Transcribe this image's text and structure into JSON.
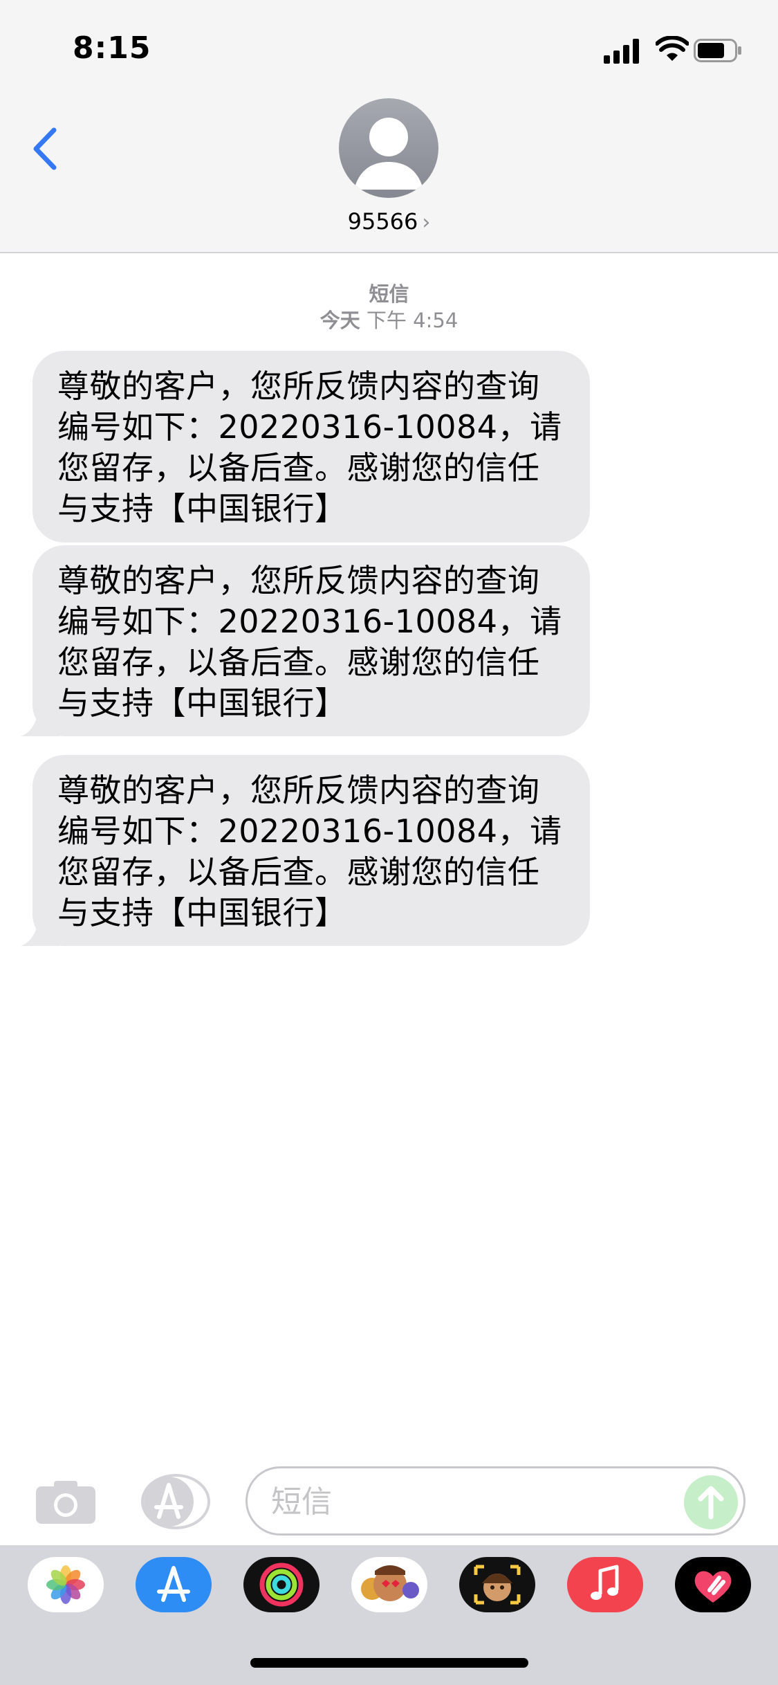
{
  "status_bar": {
    "time": "8:15"
  },
  "header": {
    "contact": "95566",
    "contact_chevron": "›"
  },
  "thread": {
    "service": "短信",
    "day": "今天",
    "time": " 下午 4:54",
    "messages": [
      {
        "text": "尊敬的客户，您所反馈内容的查询编号如下：20220316-10084，请您留存，以备后查。感谢您的信任与支持【中国银行】"
      },
      {
        "text": "尊敬的客户，您所反馈内容的查询编号如下：20220316-10084，请您留存，以备后查。感谢您的信任与支持【中国银行】"
      },
      {
        "text": "尊敬的客户，您所反馈内容的查询编号如下：20220316-10084，请您留存，以备后查。感谢您的信任与支持【中国银行】"
      }
    ]
  },
  "compose": {
    "placeholder": "短信"
  },
  "drawer": {
    "apps": [
      {
        "name": "photos-icon"
      },
      {
        "name": "app-store-icon"
      },
      {
        "name": "activity-icon"
      },
      {
        "name": "memoji-stickers-icon"
      },
      {
        "name": "memoji-icon"
      },
      {
        "name": "music-icon"
      },
      {
        "name": "digital-touch-icon"
      }
    ]
  },
  "colors": {
    "accent_blue": "#3478f6",
    "bubble_gray": "#e9e9eb",
    "send_green": "#c6efc9",
    "music_red": "#f2434f"
  }
}
